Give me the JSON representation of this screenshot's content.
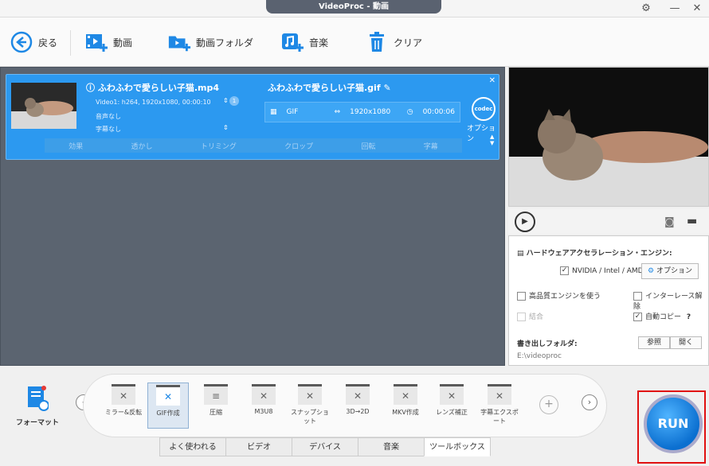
{
  "window": {
    "title": "VideoProc - 動画"
  },
  "toolbar": {
    "back": "戻る",
    "video": "動画",
    "video_folder": "動画フォルダ",
    "music": "音楽",
    "clear": "クリア"
  },
  "item": {
    "source_name": "ふわふわで愛らしい子猫.mp4",
    "video_info": "Video1: h264, 1920x1080, 00:00:10",
    "track_count": "1",
    "audio": "音声なし",
    "subtitle": "字幕なし",
    "output_name": "ふわふわで愛らしい子猫.gif",
    "format": "GIF",
    "resolution": "1920x1080",
    "duration": "00:00:06",
    "codec_label": "codec",
    "option_label": "オプション",
    "edit_tools": [
      "効果",
      "透かし",
      "トリミング",
      "クロップ",
      "回転",
      "字幕"
    ]
  },
  "settings": {
    "hw_accel_title": "ハードウェアアクセラレーション・エンジン:",
    "gpu_option": "NVIDIA / Intel / AMD",
    "option_button": "オプション",
    "high_quality": "高品質エンジンを使う",
    "deinterlace": "インターレース解除",
    "merge": "結合",
    "auto_copy": "自動コピー",
    "help": "?",
    "output_folder_label": "書き出しフォルダ:",
    "browse": "参照",
    "open": "開く",
    "output_path": "E:\\videoproc"
  },
  "format_button": "フォーマット",
  "tools": [
    {
      "label": "ミラー&反転"
    },
    {
      "label": "GIF作成"
    },
    {
      "label": "圧縮"
    },
    {
      "label": "M3U8"
    },
    {
      "label": "スナップショット"
    },
    {
      "label": "3D→2D"
    },
    {
      "label": "MKV作成"
    },
    {
      "label": "レンズ補正"
    },
    {
      "label": "字幕エクスポート"
    }
  ],
  "tabs": [
    "よく使われる",
    "ビデオ",
    "デバイス",
    "音楽",
    "ツールボックス"
  ],
  "run_label": "RUN",
  "colors": {
    "accent": "#2c99f0",
    "workspace": "#5b6470",
    "run_frame": "#e01010"
  }
}
